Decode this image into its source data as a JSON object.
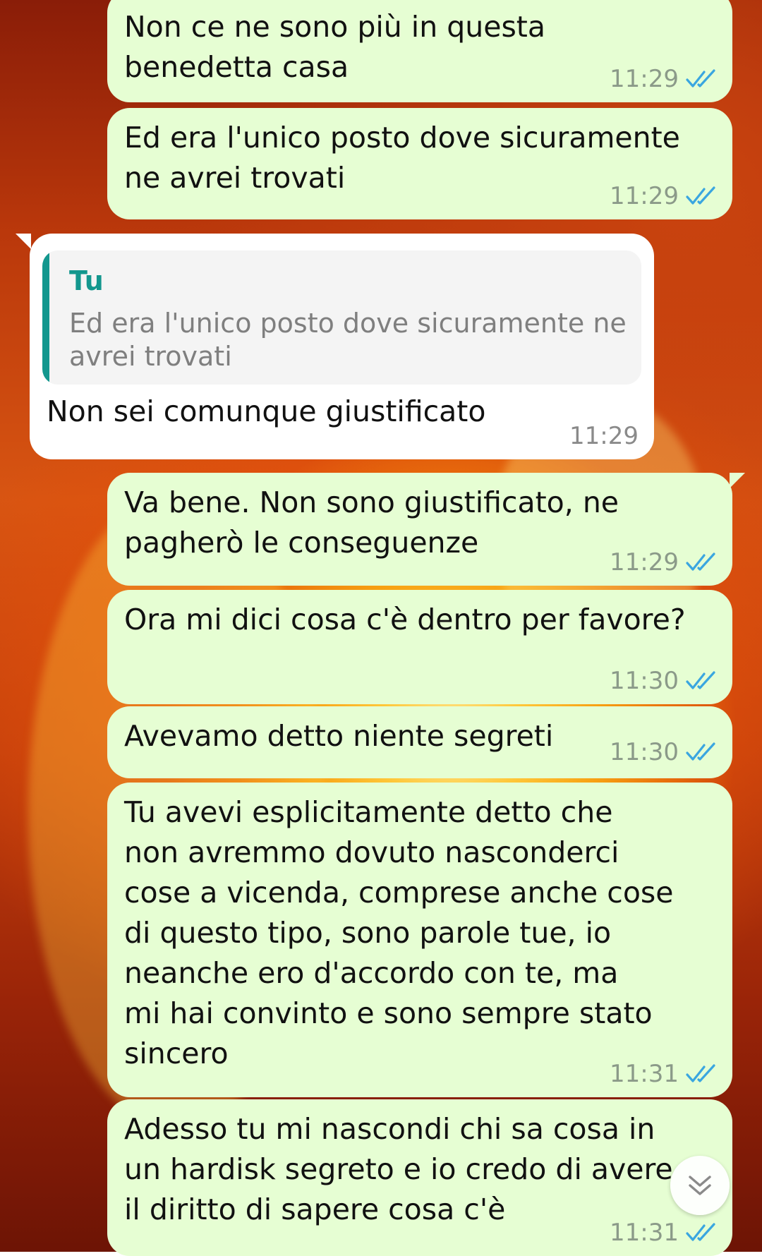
{
  "messages": [
    {
      "direction": "outgoing",
      "text": "Non ce ne sono più in questa\nbenedetta casa",
      "time": "11:29",
      "status": "read"
    },
    {
      "direction": "outgoing",
      "text": "Ed era l'unico posto dove sicuramente\nne avrei trovati",
      "time": "11:29",
      "status": "read"
    },
    {
      "direction": "incoming",
      "quote_author": "Tu",
      "quote_text": "Ed era l'unico posto dove sicuramente ne\navrei trovati",
      "text": "Non sei comunque giustificato",
      "time": "11:29"
    },
    {
      "direction": "outgoing",
      "text": "Va bene. Non sono giustificato, ne\npagherò le conseguenze",
      "time": "11:29",
      "status": "read"
    },
    {
      "direction": "outgoing",
      "text": "Ora mi dici cosa c'è dentro per favore?",
      "time": "11:30",
      "status": "read"
    },
    {
      "direction": "outgoing",
      "text": "Avevamo detto niente segreti",
      "time": "11:30",
      "status": "read"
    },
    {
      "direction": "outgoing",
      "text": "Tu avevi esplicitamente detto che\nnon avremmo dovuto nasconderci\ncose a vicenda, comprese anche cose\ndi questo tipo, sono parole tue, io\nneanche ero d'accordo con te, ma\nmi hai convinto e sono sempre stato\nsincero",
      "time": "11:31",
      "status": "read"
    },
    {
      "direction": "outgoing",
      "text": "Adesso tu mi nascondi chi sa cosa in\nun hardisk segreto e io credo di avere\nil diritto di sapere cosa c'è",
      "time": "11:31",
      "status": "read"
    }
  ],
  "icons": {
    "read_ticks": "double-check-icon",
    "scroll_down": "chevron-double-down-icon"
  },
  "colors": {
    "outgoing_bubble": "#e6fed3",
    "incoming_bubble": "#ffffff",
    "read_ticks": "#3aa6e0",
    "quote_accent": "#13978e"
  }
}
